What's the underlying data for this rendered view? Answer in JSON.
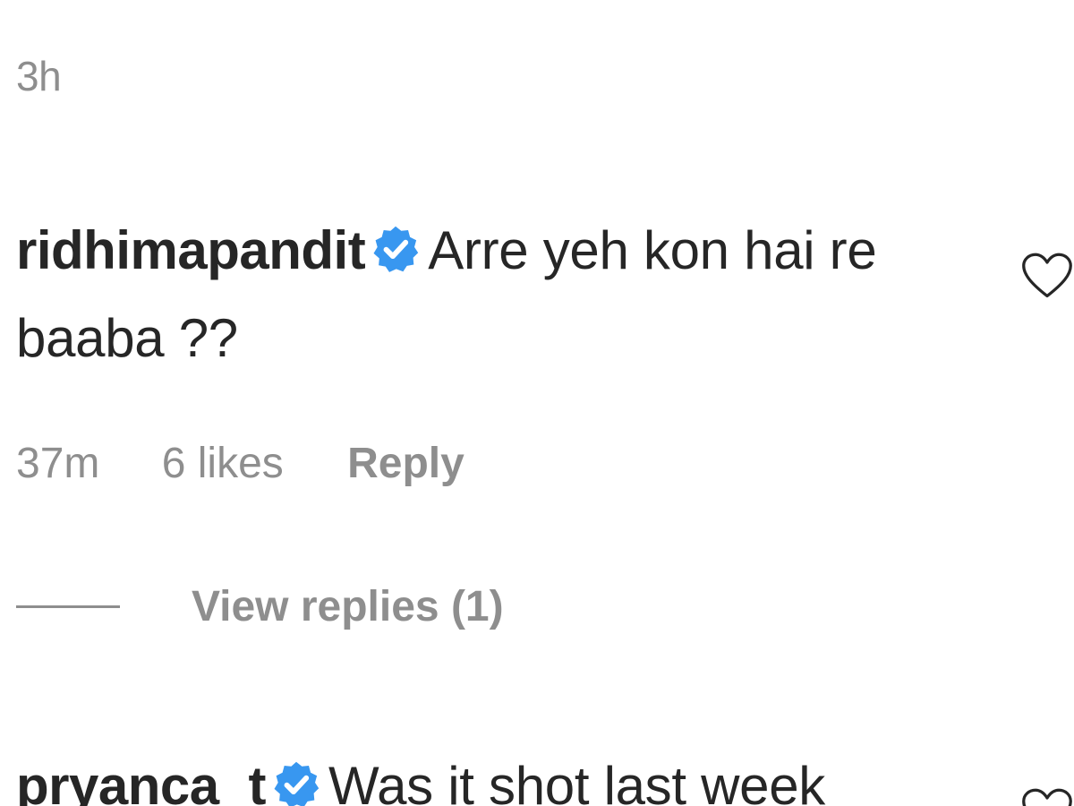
{
  "header": {
    "timestamp": "3h"
  },
  "comments": [
    {
      "username": "ridhimapandit",
      "verified": true,
      "text": "Arre yeh kon hai re baaba ??",
      "time": "37m",
      "likes": "6 likes",
      "reply_label": "Reply",
      "view_replies": "View replies (1)",
      "like_icon": "heart-outline-icon"
    },
    {
      "username": "pryanca_t",
      "verified": true,
      "text": "Was it shot last week",
      "like_icon": "heart-outline-icon"
    }
  ],
  "colors": {
    "text_primary": "#262626",
    "text_secondary": "#8e8e8e",
    "verified_blue": "#3897f0",
    "background": "#ffffff"
  }
}
